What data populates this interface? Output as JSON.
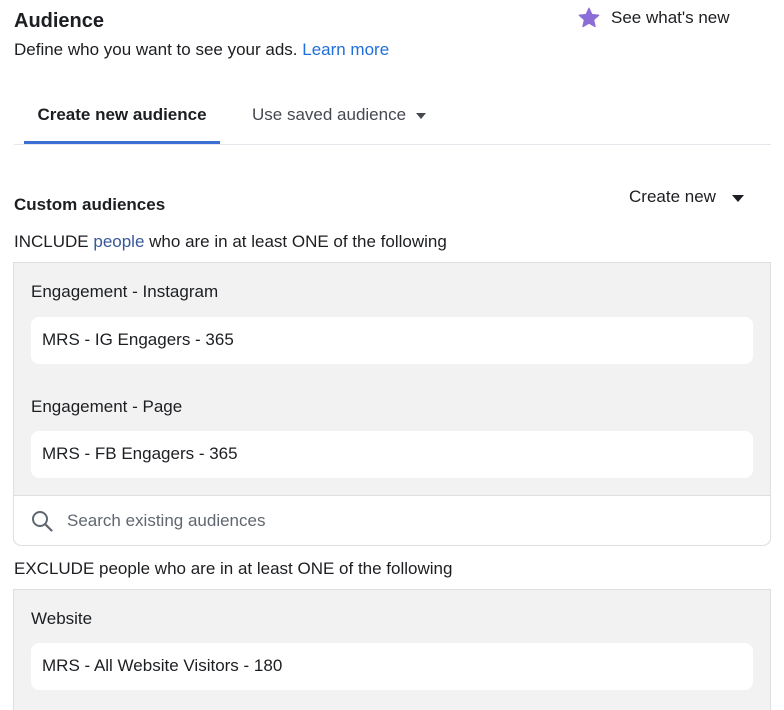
{
  "header": {
    "title": "Audience",
    "description": "Define who you want to see your ads.",
    "learn_more": "Learn more",
    "whats_new": "See what's new"
  },
  "tabs": [
    {
      "label": "Create new audience",
      "active": true
    },
    {
      "label": "Use saved audience",
      "active": false
    }
  ],
  "custom_audiences": {
    "title": "Custom audiences",
    "create_new": "Create new",
    "include": {
      "prefix": "INCLUDE",
      "link": "people",
      "suffix": "who are in at least ONE of the following",
      "groups": [
        {
          "label": "Engagement - Instagram",
          "audience": "MRS - IG Engagers - 365"
        },
        {
          "label": "Engagement - Page",
          "audience": "MRS - FB Engagers - 365"
        }
      ],
      "search_placeholder": "Search existing audiences"
    },
    "exclude": {
      "text": "EXCLUDE people who are in at least ONE of the following",
      "groups": [
        {
          "label": "Website",
          "audience": "MRS - All Website Visitors - 180"
        }
      ]
    }
  },
  "icons": {
    "whats_new": "star-icon",
    "search": "search-icon",
    "dropdown": "caret-down-icon"
  },
  "colors": {
    "link": "#216fdb",
    "people_link": "#385898",
    "star": "#8b6dd8",
    "tab_underline": "#3b6fd4",
    "group_bg": "#f2f2f2"
  }
}
